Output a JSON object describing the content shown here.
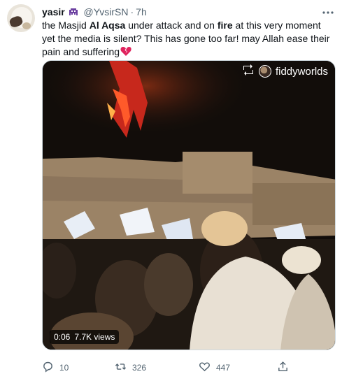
{
  "tweet": {
    "display_name": "yasir",
    "handle": "@YvsirSN",
    "separator": "·",
    "time": "7h",
    "text": {
      "part1": "the Masjid ",
      "bold1": "Al Aqsa",
      "part2": " under attack and on ",
      "bold2": "fire",
      "part3": " at this very moment yet the media is silent? This has gone too far! may Allah ease their pain and suffering"
    },
    "media": {
      "watermark_user": "fiddyworlds",
      "duration": "0:06",
      "views": "7.7K views"
    },
    "actions": {
      "replies": "10",
      "retweets": "326",
      "likes": "447"
    }
  },
  "colors": {
    "text": "#0f1419",
    "secondary": "#536471",
    "name_badge": "#6b3fa0",
    "heart": "#e0245e",
    "fire": "#ff3b1f"
  },
  "icons": {
    "badge": "alien-monster-icon",
    "more": "more-icon",
    "reply": "reply-icon",
    "retweet": "retweet-icon",
    "like": "heart-icon",
    "share": "share-icon",
    "emoji": "broken-heart-icon",
    "repost_watermark": "repost-icon"
  }
}
